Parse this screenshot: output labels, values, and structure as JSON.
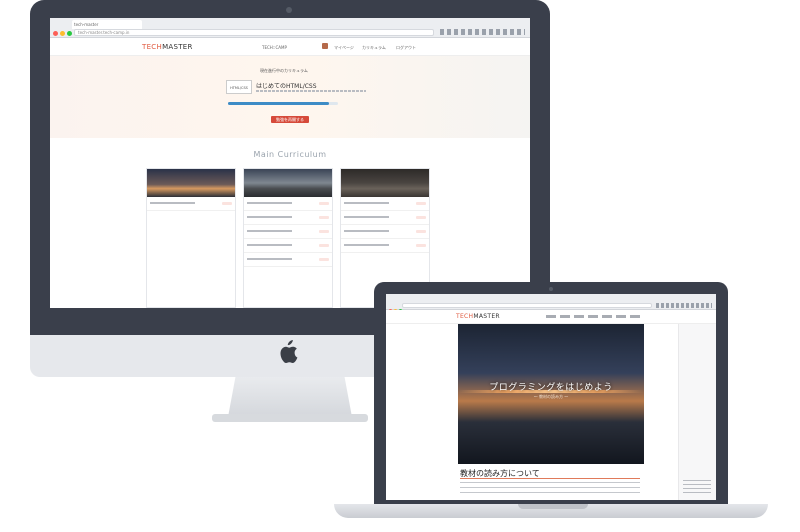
{
  "desktop": {
    "browser": {
      "tab_title": "tech-master",
      "url": "tech-master.tech-camp.in"
    },
    "site": {
      "logo_prefix": "TECH",
      "logo_suffix": "MASTER",
      "nav_items": [
        "TECH::CAMP",
        "マイページ",
        "カリキュラム",
        "ログアウト"
      ]
    },
    "hero": {
      "label": "現在進行中のカリキュラム",
      "course_badge": "HTML/CSS",
      "course_title": "はじめてのHTML/CSS",
      "course_sub": "",
      "progress_fraction": 0.92,
      "progress_text": "",
      "button_label": "勉強を再開する"
    },
    "main_curriculum": {
      "title": "Main Curriculum",
      "cards": [
        {
          "header": "",
          "rows": [
            ""
          ]
        },
        {
          "header": "",
          "rows": [
            "",
            "",
            "",
            "",
            ""
          ]
        },
        {
          "header": "",
          "rows": [
            "",
            "",
            "",
            ""
          ]
        }
      ]
    }
  },
  "laptop": {
    "site": {
      "logo_prefix": "TECH",
      "logo_suffix": "MASTER"
    },
    "hero": {
      "title": "プログラミングをはじめよう",
      "subtitle": "〜 教材の読み方 〜"
    },
    "section": {
      "heading": "教材の読み方について",
      "body": ""
    }
  },
  "colors": {
    "bezel": "#3a3f4b",
    "accent_red": "#d64a3a",
    "progress_blue": "#3d8cc6",
    "logo_accent": "#e05a3f"
  }
}
